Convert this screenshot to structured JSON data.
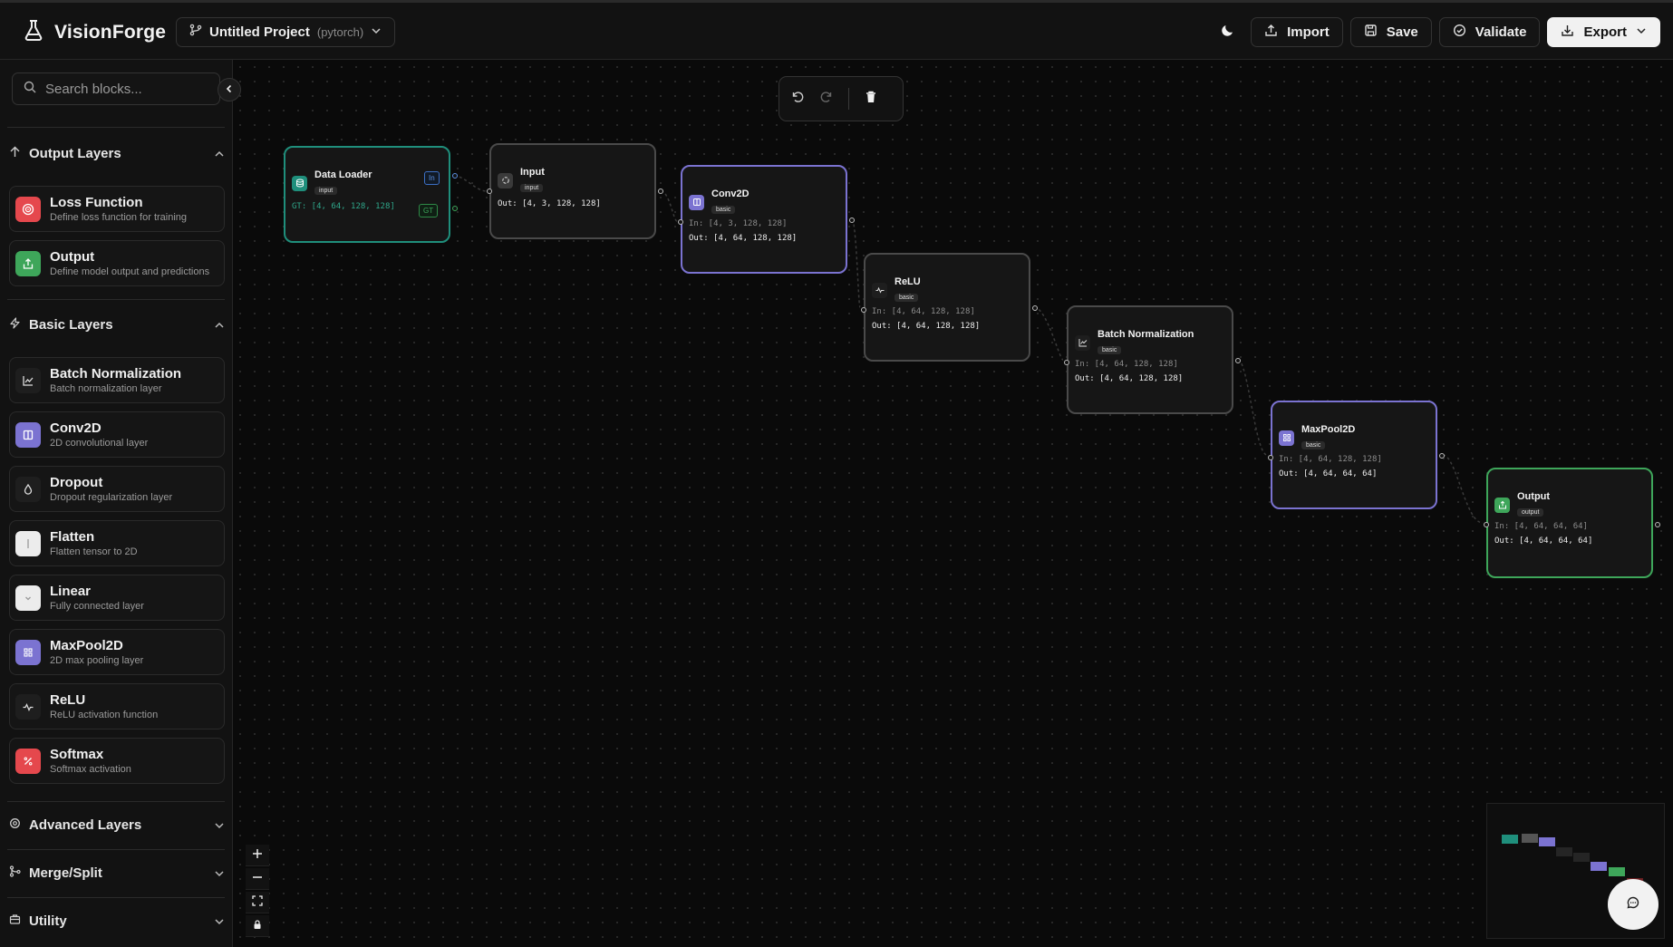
{
  "header": {
    "brand": "VisionForge",
    "project_name": "Untitled Project",
    "project_framework": "(pytorch)",
    "buttons": {
      "import": "Import",
      "save": "Save",
      "validate": "Validate",
      "export": "Export"
    }
  },
  "sidebar": {
    "search_placeholder": "Search blocks...",
    "sections": {
      "output": "Output Layers",
      "basic": "Basic Layers",
      "advanced": "Advanced Layers",
      "merge": "Merge/Split",
      "utility": "Utility"
    },
    "output_items": [
      {
        "title": "Loss Function",
        "desc": "Define loss function for training"
      },
      {
        "title": "Output",
        "desc": "Define model output and predictions"
      }
    ],
    "basic_items": [
      {
        "title": "Batch Normalization",
        "desc": "Batch normalization layer"
      },
      {
        "title": "Conv2D",
        "desc": "2D convolutional layer"
      },
      {
        "title": "Dropout",
        "desc": "Dropout regularization layer"
      },
      {
        "title": "Flatten",
        "desc": "Flatten tensor to 2D"
      },
      {
        "title": "Linear",
        "desc": "Fully connected layer"
      },
      {
        "title": "MaxPool2D",
        "desc": "2D max pooling layer"
      },
      {
        "title": "ReLU",
        "desc": "ReLU activation function"
      },
      {
        "title": "Softmax",
        "desc": "Softmax activation"
      }
    ]
  },
  "colors": {
    "teal": "#1f8f7c",
    "purple": "#7b73d1",
    "green": "#3ea65a",
    "red": "#e5484d"
  },
  "nodes": {
    "dataloader": {
      "title": "Data Loader",
      "badge": "input",
      "tag_in": "In",
      "tag_gt": "GT",
      "gt": "GT: [4, 64, 128, 128]"
    },
    "input": {
      "title": "Input",
      "badge": "input",
      "out": "Out: [4, 3, 128, 128]"
    },
    "conv": {
      "title": "Conv2D",
      "badge": "basic",
      "in": "In: [4, 3, 128, 128]",
      "out": "Out: [4, 64, 128, 128]"
    },
    "relu": {
      "title": "ReLU",
      "badge": "basic",
      "in": "In: [4, 64, 128, 128]",
      "out": "Out: [4, 64, 128, 128]"
    },
    "bn": {
      "title": "Batch Normalization",
      "badge": "basic",
      "in": "In: [4, 64, 128, 128]",
      "out": "Out: [4, 64, 128, 128]"
    },
    "pool": {
      "title": "MaxPool2D",
      "badge": "basic",
      "in": "In: [4, 64, 128, 128]",
      "out": "Out: [4, 64, 64, 64]"
    },
    "output": {
      "title": "Output",
      "badge": "output",
      "in": "In: [4, 64, 64, 64]",
      "out": "Out: [4, 64, 64, 64]"
    }
  }
}
